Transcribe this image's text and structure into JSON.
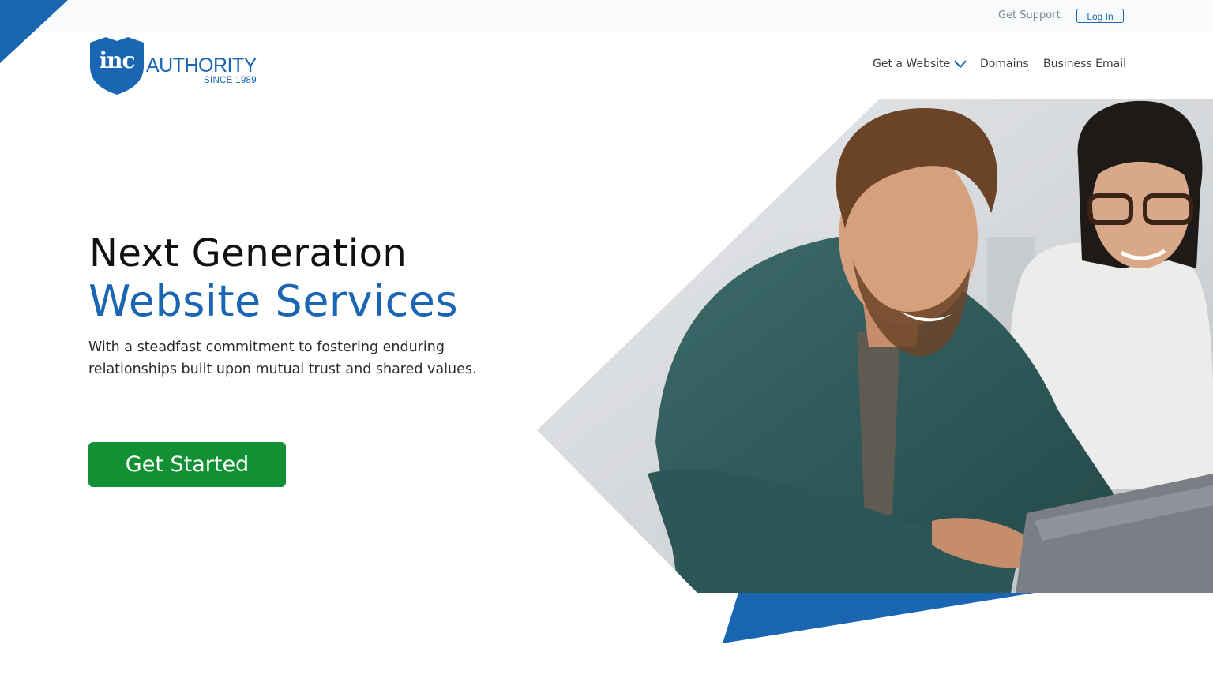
{
  "topbar": {
    "support_label": "Get Support",
    "login_label": "Log In"
  },
  "logo": {
    "inc": "inc",
    "authority": "AUTHORITY",
    "since": "SINCE 1989"
  },
  "nav": {
    "items": [
      {
        "label": "Get a Website",
        "icon": "chevron-down-icon"
      },
      {
        "label": "Domains"
      },
      {
        "label": "Business Email"
      }
    ]
  },
  "hero": {
    "title_line1": "Next Generation",
    "title_line2": "Website Services",
    "subtitle": "With a steadfast commitment to fostering enduring relationships built upon mutual trust and shared values.",
    "cta_label": "Get Started"
  },
  "colors": {
    "brand_blue": "#1a66b3",
    "cta_green": "#119134"
  }
}
